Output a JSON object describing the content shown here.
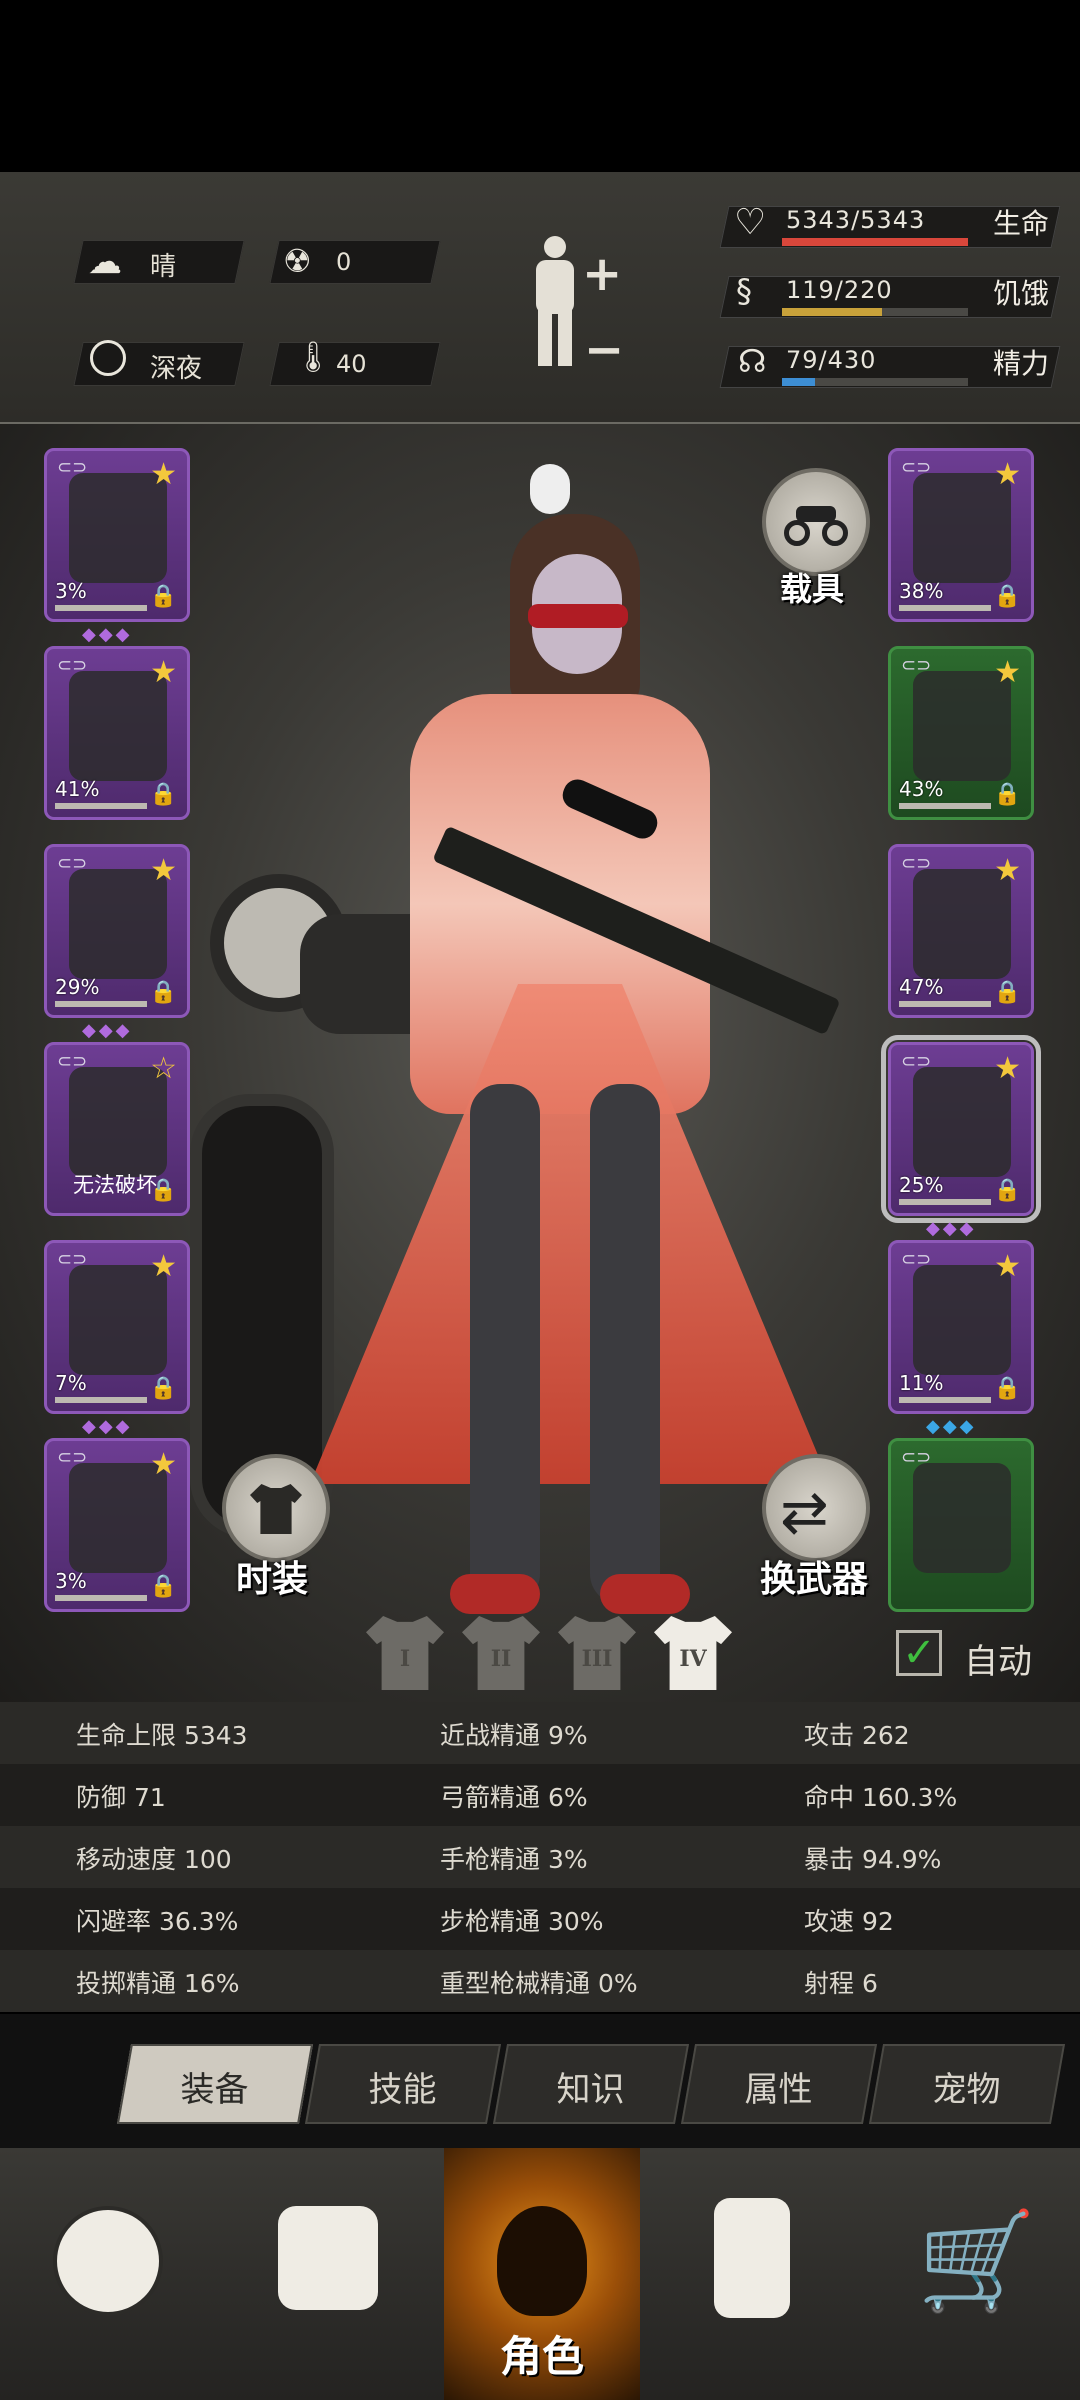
{
  "environment": {
    "weather": "晴",
    "radiation": "0",
    "time_of_day": "深夜",
    "temperature": "40"
  },
  "vitals": [
    {
      "label": "生命",
      "value": "5343/5343",
      "fill": 1.0,
      "color": "#d9473b"
    },
    {
      "label": "饥饿",
      "value": "119/220",
      "fill": 0.54,
      "color": "#c9a23a"
    },
    {
      "label": "精力",
      "value": "79/430",
      "fill": 0.18,
      "color": "#3d8ed4"
    }
  ],
  "left_slots": [
    {
      "icon": "helmet-icon",
      "pct": "3%",
      "star": "filled",
      "gems": "◆◆◆",
      "color": "purple"
    },
    {
      "icon": "jacket-icon",
      "pct": "41%",
      "star": "filled",
      "gems": "",
      "color": "purple"
    },
    {
      "icon": "camo-suit-icon",
      "pct": "29%",
      "star": "filled",
      "gems": "◆◆◆",
      "color": "purple"
    },
    {
      "icon": "backpack-icon",
      "pct": "",
      "note": "无法破坏",
      "star": "hollow",
      "gems": "",
      "color": "purple"
    },
    {
      "icon": "camo-pants-icon",
      "pct": "7%",
      "star": "filled",
      "gems": "◆◆◆",
      "color": "purple"
    },
    {
      "icon": "boots-icon",
      "pct": "3%",
      "star": "filled",
      "gems": "",
      "color": "purple"
    }
  ],
  "right_slots": [
    {
      "icon": "goggles-icon",
      "pct": "38%",
      "star": "filled",
      "gems": "",
      "color": "purple"
    },
    {
      "icon": "mask-icon",
      "pct": "43%",
      "star": "filled",
      "gems": "",
      "color": "green"
    },
    {
      "icon": "vest-icon",
      "pct": "47%",
      "star": "filled",
      "gems": "",
      "color": "purple"
    },
    {
      "icon": "rifle-icon",
      "pct": "25%",
      "star": "filled",
      "gems": "◆◆◆",
      "color": "purple",
      "selected": true
    },
    {
      "icon": "spear-icon",
      "pct": "11%",
      "star": "filled",
      "gems": "◆◆◆",
      "gem_color": "#3ba7e6",
      "color": "purple"
    },
    {
      "icon": "arrow-icon",
      "pct": "",
      "star": "none",
      "gems": "",
      "color": "green"
    }
  ],
  "buttons": {
    "vehicle": "载具",
    "fashion": "时装",
    "switch_weapon": "换武器",
    "auto": "自动"
  },
  "outfit_tabs": [
    "I",
    "II",
    "III",
    "IV"
  ],
  "stats": [
    [
      "生命上限 5343",
      "近战精通 9%",
      "攻击 262"
    ],
    [
      "防御 71",
      "弓箭精通 6%",
      "命中 160.3%"
    ],
    [
      "移动速度 100",
      "手枪精通 3%",
      "暴击 94.9%"
    ],
    [
      "闪避率 36.3%",
      "步枪精通 30%",
      "攻速 92"
    ],
    [
      "投掷精通 16%",
      "重型枪械精通 0%",
      "射程 6"
    ]
  ],
  "tabs": [
    "装备",
    "技能",
    "知识",
    "属性",
    "宠物"
  ],
  "nav": [
    {
      "icon": "globe-icon",
      "label": ""
    },
    {
      "icon": "backpack-icon",
      "label": ""
    },
    {
      "icon": "character-head-icon",
      "label": "角色"
    },
    {
      "icon": "radio-icon",
      "label": ""
    },
    {
      "icon": "cart-icon",
      "label": ""
    }
  ]
}
